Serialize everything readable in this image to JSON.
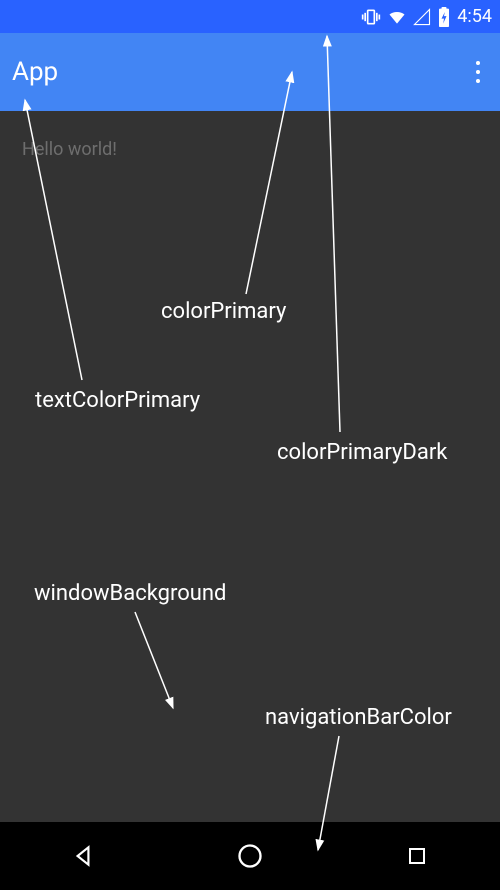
{
  "statusBar": {
    "time": "4:54"
  },
  "appBar": {
    "title": "App"
  },
  "content": {
    "text": "Hello world!"
  },
  "labels": {
    "colorPrimary": "colorPrimary",
    "textColorPrimary": "textColorPrimary",
    "colorPrimaryDark": "colorPrimaryDark",
    "windowBackground": "windowBackground",
    "navigationBarColor": "navigationBarColor"
  },
  "colors": {
    "colorPrimaryDark": "#2962ff",
    "colorPrimary": "#4285f4",
    "windowBackground": "#333333",
    "navigationBarColor": "#000000",
    "textColorPrimary": "#ffffff"
  }
}
